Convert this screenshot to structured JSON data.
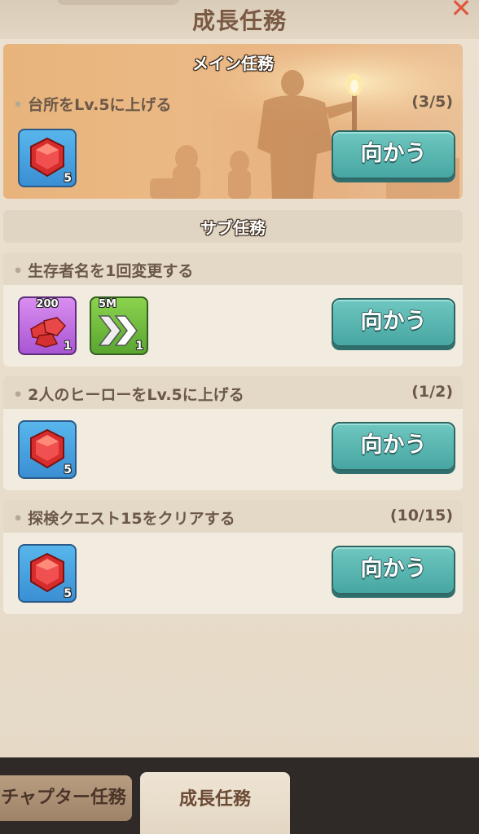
{
  "header": {
    "title": "成長任務",
    "close_symbol": "✕"
  },
  "main": {
    "section_title": "メイン任務",
    "task": {
      "text": "台所をLv.5に上げる",
      "progress": "(3/5)"
    },
    "rewards": [
      {
        "icon": "ruby-gem-icon",
        "qty": "5"
      }
    ],
    "go_label": "向かう"
  },
  "sub": {
    "section_title": "サブ任務",
    "tasks": [
      {
        "text": "生存者名を1回変更する",
        "progress": "",
        "rewards": [
          {
            "icon": "ruby-pile-icon",
            "top": "200",
            "qty": "1"
          },
          {
            "icon": "speedup-5m-icon",
            "top": "5M",
            "qty": "1"
          }
        ],
        "go_label": "向かう"
      },
      {
        "text": "2人のヒーローをLv.5に上げる",
        "progress": "(1/2)",
        "rewards": [
          {
            "icon": "ruby-gem-icon",
            "qty": "5"
          }
        ],
        "go_label": "向かう"
      },
      {
        "text": "探検クエスト15をクリアする",
        "progress": "(10/15)",
        "rewards": [
          {
            "icon": "ruby-gem-icon",
            "qty": "5"
          }
        ],
        "go_label": "向かう"
      }
    ]
  },
  "tabs": {
    "chapter": "チャプター任務",
    "growth": "成長任務"
  },
  "colors": {
    "accent_button": "#47a6a2",
    "panel": "#ece1d0",
    "title": "#7b5a44"
  }
}
